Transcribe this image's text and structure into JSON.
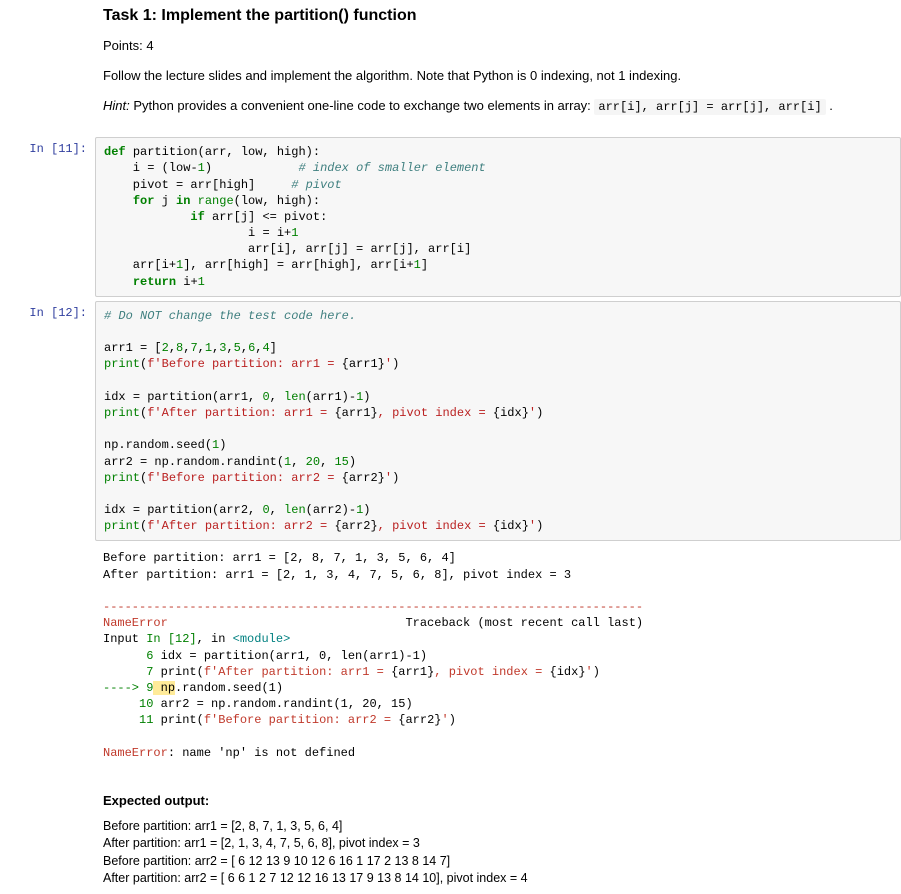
{
  "markdown": {
    "heading": "Task 1: Implement the partition() function",
    "points": "Points: 4",
    "instr": "Follow the lecture slides and implement the algorithm. Note that Python is 0 indexing, not 1 indexing.",
    "hint_label": "Hint:",
    "hint_text": " Python provides a convenient one-line code to exchange two elements in array: ",
    "hint_code": "arr[i], arr[j] = arr[j], arr[i]",
    "hint_after": " ."
  },
  "cells": [
    {
      "prompt": "In [11]:",
      "lines": [
        [
          {
            "t": "def ",
            "c": "kw"
          },
          {
            "t": "partition(arr, low, high):"
          }
        ],
        [
          {
            "t": "    i "
          },
          {
            "t": "="
          },
          {
            "t": " (low"
          },
          {
            "t": "-"
          },
          {
            "t": "1",
            "c": "num"
          },
          {
            "t": ")            "
          },
          {
            "t": "# index of smaller element",
            "c": "com"
          }
        ],
        [
          {
            "t": "    pivot "
          },
          {
            "t": "="
          },
          {
            "t": " arr[high]     "
          },
          {
            "t": "# pivot",
            "c": "com"
          }
        ],
        [
          {
            "t": "    ",
            "c": ""
          },
          {
            "t": "for ",
            "c": "kw"
          },
          {
            "t": "j "
          },
          {
            "t": "in ",
            "c": "kw"
          },
          {
            "t": "range",
            "c": "bi"
          },
          {
            "t": "(low, high):"
          }
        ],
        [
          {
            "t": "            ",
            "c": ""
          },
          {
            "t": "if ",
            "c": "kw"
          },
          {
            "t": "arr[j] "
          },
          {
            "t": "<="
          },
          {
            "t": " pivot:"
          }
        ],
        [
          {
            "t": "                    i "
          },
          {
            "t": "="
          },
          {
            "t": " i"
          },
          {
            "t": "+"
          },
          {
            "t": "1",
            "c": "num"
          }
        ],
        [
          {
            "t": "                    arr[i], arr[j] "
          },
          {
            "t": "="
          },
          {
            "t": " arr[j], arr[i]"
          }
        ],
        [
          {
            "t": "    arr[i"
          },
          {
            "t": "+"
          },
          {
            "t": "1",
            "c": "num"
          },
          {
            "t": "], arr[high] "
          },
          {
            "t": "="
          },
          {
            "t": " arr[high], arr[i"
          },
          {
            "t": "+"
          },
          {
            "t": "1",
            "c": "num"
          },
          {
            "t": "]"
          }
        ],
        [
          {
            "t": "    ",
            "c": ""
          },
          {
            "t": "return ",
            "c": "kw"
          },
          {
            "t": "i"
          },
          {
            "t": "+"
          },
          {
            "t": "1",
            "c": "num"
          }
        ]
      ]
    },
    {
      "prompt": "In [12]:",
      "lines": [
        [
          {
            "t": "# Do NOT change the test code here.",
            "c": "com"
          }
        ],
        [
          {
            "t": ""
          }
        ],
        [
          {
            "t": "arr1 "
          },
          {
            "t": "="
          },
          {
            "t": " ["
          },
          {
            "t": "2",
            "c": "num"
          },
          {
            "t": ","
          },
          {
            "t": "8",
            "c": "num"
          },
          {
            "t": ","
          },
          {
            "t": "7",
            "c": "num"
          },
          {
            "t": ","
          },
          {
            "t": "1",
            "c": "num"
          },
          {
            "t": ","
          },
          {
            "t": "3",
            "c": "num"
          },
          {
            "t": ","
          },
          {
            "t": "5",
            "c": "num"
          },
          {
            "t": ","
          },
          {
            "t": "6",
            "c": "num"
          },
          {
            "t": ","
          },
          {
            "t": "4",
            "c": "num"
          },
          {
            "t": "]"
          }
        ],
        [
          {
            "t": "print",
            "c": "bi"
          },
          {
            "t": "("
          },
          {
            "t": "f'Before partition: arr1 = ",
            "c": "str"
          },
          {
            "t": "{arr1}"
          },
          {
            "t": "'",
            "c": "str"
          },
          {
            "t": ")"
          }
        ],
        [
          {
            "t": ""
          }
        ],
        [
          {
            "t": "idx "
          },
          {
            "t": "="
          },
          {
            "t": " partition(arr1, "
          },
          {
            "t": "0",
            "c": "num"
          },
          {
            "t": ", "
          },
          {
            "t": "len",
            "c": "bi"
          },
          {
            "t": "(arr1)"
          },
          {
            "t": "-"
          },
          {
            "t": "1",
            "c": "num"
          },
          {
            "t": ")"
          }
        ],
        [
          {
            "t": "print",
            "c": "bi"
          },
          {
            "t": "("
          },
          {
            "t": "f'After partition: arr1 = ",
            "c": "str"
          },
          {
            "t": "{arr1}"
          },
          {
            "t": ", pivot index = ",
            "c": "str"
          },
          {
            "t": "{idx}"
          },
          {
            "t": "'",
            "c": "str"
          },
          {
            "t": ")"
          }
        ],
        [
          {
            "t": ""
          }
        ],
        [
          {
            "t": "np.random.seed("
          },
          {
            "t": "1",
            "c": "num"
          },
          {
            "t": ")"
          }
        ],
        [
          {
            "t": "arr2 "
          },
          {
            "t": "="
          },
          {
            "t": " np.random.randint("
          },
          {
            "t": "1",
            "c": "num"
          },
          {
            "t": ", "
          },
          {
            "t": "20",
            "c": "num"
          },
          {
            "t": ", "
          },
          {
            "t": "15",
            "c": "num"
          },
          {
            "t": ")"
          }
        ],
        [
          {
            "t": "print",
            "c": "bi"
          },
          {
            "t": "("
          },
          {
            "t": "f'Before partition: arr2 = ",
            "c": "str"
          },
          {
            "t": "{arr2}"
          },
          {
            "t": "'",
            "c": "str"
          },
          {
            "t": ")"
          }
        ],
        [
          {
            "t": ""
          }
        ],
        [
          {
            "t": "idx "
          },
          {
            "t": "="
          },
          {
            "t": " partition(arr2, "
          },
          {
            "t": "0",
            "c": "num"
          },
          {
            "t": ", "
          },
          {
            "t": "len",
            "c": "bi"
          },
          {
            "t": "(arr2)"
          },
          {
            "t": "-"
          },
          {
            "t": "1",
            "c": "num"
          },
          {
            "t": ")"
          }
        ],
        [
          {
            "t": "print",
            "c": "bi"
          },
          {
            "t": "("
          },
          {
            "t": "f'After partition: arr2 = ",
            "c": "str"
          },
          {
            "t": "{arr2}"
          },
          {
            "t": ", pivot index = ",
            "c": "str"
          },
          {
            "t": "{idx}"
          },
          {
            "t": "'",
            "c": "str"
          },
          {
            "t": ")"
          }
        ]
      ]
    }
  ],
  "output": {
    "stdout": [
      "Before partition: arr1 = [2, 8, 7, 1, 3, 5, 6, 4]",
      "After partition: arr1 = [2, 1, 3, 4, 7, 5, 6, 8], pivot index = 3"
    ],
    "tb_sep": "---------------------------------------------------------------------------",
    "tb_name": "NameError",
    "tb_trace": "                                 Traceback (most recent call last)",
    "tb_input_a": "Input ",
    "tb_input_b": "In [12]",
    "tb_input_c": ", in ",
    "tb_input_d": "<module>",
    "l6": "      6",
    "l6t": " idx = partition(arr1, 0, len(arr1)-1)",
    "l7": "      7",
    "l7a": " print(",
    "l7b": "f'After partition: arr1 = ",
    "l7c": "{arr1}",
    "l7d": ", pivot index = ",
    "l7e": "{idx}",
    "l7f": "'",
    "l7g": ")",
    "arrow": "----> ",
    "l9": "9",
    "l9hl": " np",
    "l9t": ".random.seed(1)",
    "l10": "     10",
    "l10t": " arr2 = np.random.randint(1, 20, 15)",
    "l11": "     11",
    "l11a": " print(",
    "l11b": "f'Before partition: arr2 = ",
    "l11c": "{arr2}",
    "l11d": "'",
    "l11e": ")",
    "err_final_a": "NameError",
    "err_final_b": ": name 'np' is not defined"
  },
  "expected": {
    "heading": "Expected output:",
    "lines": [
      "Before partition: arr1 = [2, 8, 7, 1, 3, 5, 6, 4]",
      "After partition: arr1 = [2, 1, 3, 4, 7, 5, 6, 8], pivot index = 3",
      "Before partition: arr2 = [ 6 12 13 9 10 12 6 16 1 17 2 13 8 14 7]",
      "After partition: arr2 = [ 6 6 1 2 7 12 12 16 13 17 9 13 8 14 10], pivot index = 4"
    ]
  }
}
